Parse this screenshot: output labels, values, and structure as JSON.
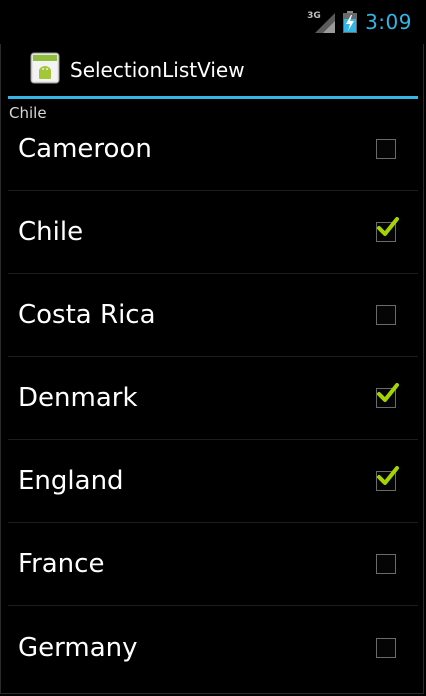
{
  "status_bar": {
    "network": "3G",
    "time": "3:09"
  },
  "action_bar": {
    "title": "SelectionListView",
    "icon": "android-app-icon"
  },
  "selection_text": "Chile",
  "colors": {
    "accent": "#33b5e5",
    "check": "#a6d400",
    "background": "#000000"
  },
  "list": {
    "items": [
      {
        "label": "Cameroon",
        "checked": false
      },
      {
        "label": "Chile",
        "checked": true
      },
      {
        "label": "Costa Rica",
        "checked": false
      },
      {
        "label": "Denmark",
        "checked": true
      },
      {
        "label": "England",
        "checked": true
      },
      {
        "label": "France",
        "checked": false
      },
      {
        "label": "Germany",
        "checked": false
      }
    ]
  }
}
